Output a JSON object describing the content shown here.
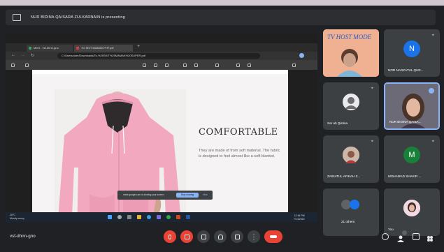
{
  "presenter_banner": "NUR BIDINA QAISARA ZULKARNAIN is presenting",
  "browser": {
    "tabs": [
      "Meet - vsf-dhnn-gno",
      "TO SKIT MAMAK.PHF.pdf"
    ],
    "url": "C:/Users/user/Downloads/To-%20SKIT%20MAMAK%20SUPER.pdf"
  },
  "slide": {
    "headline": "COMFORTABLE",
    "body": "They are made of from soft material. The fabric is designed to feel almost like a soft blanket."
  },
  "share_notice": {
    "text": "meet.google.com is sharing your screen.",
    "stop_label": "Stop sharing",
    "hide_label": "Hide"
  },
  "taskbar": {
    "weather_temp": "28°C",
    "weather_desc": "Mostly sunny",
    "time": "12:46 PM",
    "date": "7/14/2022"
  },
  "participants": [
    {
      "name": "",
      "banner": "TV HOST MODE"
    },
    {
      "name": "NOR NADZATUL QUR...",
      "initial": "N",
      "color": "#1a73e8"
    },
    {
      "name": "Sar ah Qistina"
    },
    {
      "name": "NUR BIDINA QAISA..."
    },
    {
      "name": "ZAINATUL AFIKAH Z..."
    },
    {
      "name": "MOHAMAD SHAKIR ...",
      "initial": "M",
      "color": "#188038"
    },
    {
      "name": "21 others"
    },
    {
      "name": "You"
    }
  ],
  "meeting_code": "vsf-dhnn-gno",
  "colors": {
    "meet_bg": "#202124",
    "tile_bg": "#3c4043",
    "end_call": "#ea4335",
    "active_speaker": "#8ab4f8",
    "hoodie": "#f2a9bf"
  }
}
